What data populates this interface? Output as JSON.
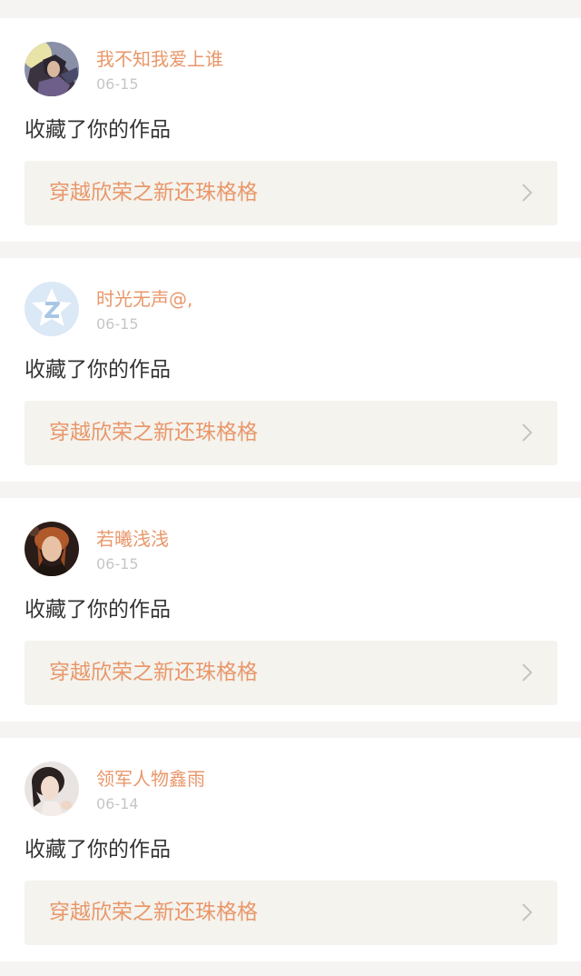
{
  "notifications": [
    {
      "username": "我不知我爱上谁",
      "date": "06-15",
      "action": "收藏了你的作品",
      "work_title": "穿越欣荣之新还珠格格",
      "avatar_icon": "anime-character-avatar"
    },
    {
      "username": "时光无声@,",
      "date": "06-15",
      "action": "收藏了你的作品",
      "work_title": "穿越欣荣之新还珠格格",
      "avatar_icon": "default-star-avatar"
    },
    {
      "username": "若曦浅浅",
      "date": "06-15",
      "action": "收藏了你的作品",
      "work_title": "穿越欣荣之新还珠格格",
      "avatar_icon": "portrait-avatar"
    },
    {
      "username": "领军人物鑫雨",
      "date": "06-14",
      "action": "收藏了你的作品",
      "work_title": "穿越欣荣之新还珠格格",
      "avatar_icon": "portrait-avatar"
    }
  ],
  "colors": {
    "accent": "#e9976a",
    "page_background": "#f6f4f3",
    "link_background": "#f4f3ee"
  }
}
